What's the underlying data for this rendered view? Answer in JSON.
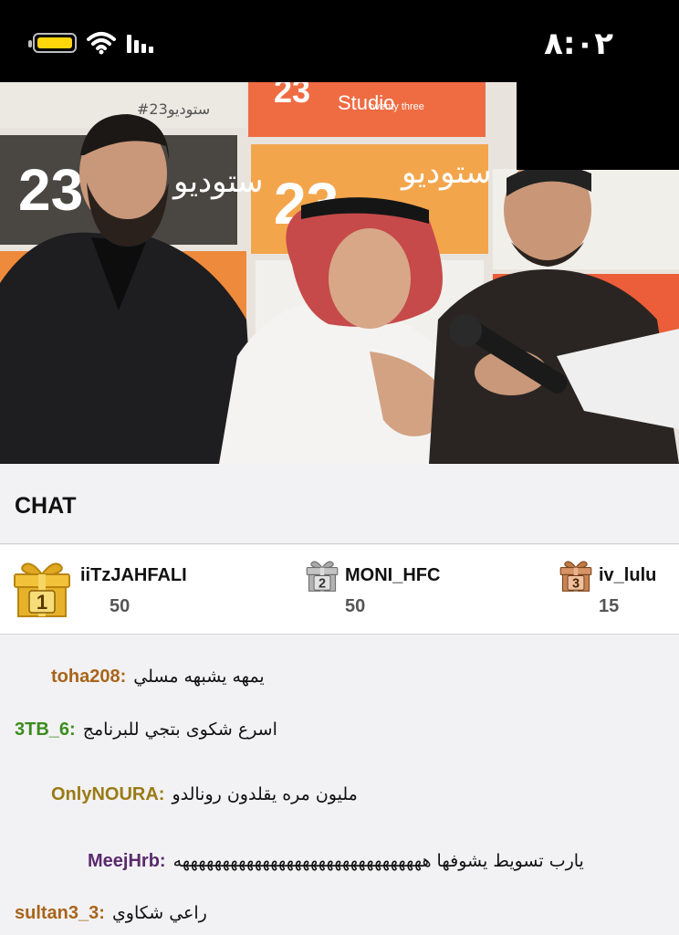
{
  "status_bar": {
    "time": "٨:٠٢",
    "battery_level": 0.85,
    "battery_color": "#ffd60a"
  },
  "video": {
    "backdrop_logo_text": "23",
    "backdrop_arabic": "ستوديو",
    "backdrop_brand": "Studio",
    "backdrop_sub": "twenty three",
    "backdrop_hashtag": "#ستوديو23"
  },
  "chat": {
    "title": "CHAT"
  },
  "leaderboard": [
    {
      "rank": "1",
      "name": "iiTzJAHFALI",
      "score": "50",
      "color": "#d9a520"
    },
    {
      "rank": "2",
      "name": "MONI_HFC",
      "score": "50",
      "color": "#8f8f8f"
    },
    {
      "rank": "3",
      "name": "iv_lulu",
      "score": "15",
      "color": "#b06a3a"
    }
  ],
  "messages": [
    {
      "user": "toha208:",
      "text": "يمهه يشبهه مسلي",
      "color": "#a8651a"
    },
    {
      "user": "3TB_6:",
      "text": "اسرع شكوى بتجي للبرنامج",
      "color": "#3c8c1e"
    },
    {
      "user": "OnlyNOURA:",
      "text": "مليون مره يقلدون رونالدو",
      "color": "#9a7a14"
    },
    {
      "user": "MeejHrb:",
      "text": "يارب تسويط يشوفها هههههههههههههههههههههههههههههههه",
      "color": "#5a2a6e"
    },
    {
      "user": "sultan3_3:",
      "text": "راعي شكاوي",
      "color": "#a8651a"
    }
  ]
}
